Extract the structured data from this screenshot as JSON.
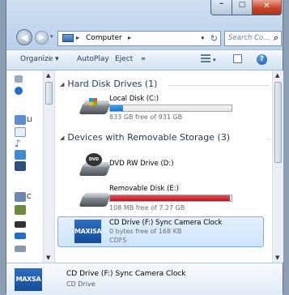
{
  "address": {
    "crumb": "Computer",
    "search_placeholder": "Search Co..."
  },
  "toolbar": {
    "organize": "Organize ▾",
    "autoplay": "AutoPlay",
    "eject": "Eject",
    "more": "»"
  },
  "nav_labels": [
    "Li",
    "C"
  ],
  "groups": [
    {
      "title": "Hard Disk Drives (1)"
    },
    {
      "title": "Devices with Removable Storage (3)"
    }
  ],
  "drives": [
    {
      "name": "Local Disk (C:)",
      "free": "833 GB free of 931 GB",
      "used_fraction": 0.105,
      "bar_color": "blue"
    },
    {
      "name": "DVD RW Drive (D:)"
    },
    {
      "name": "Removable Disk (E:)",
      "free": "108 MB free of 7.27 GB",
      "used_fraction": 0.985,
      "bar_color": "red"
    },
    {
      "name": "CD Drive (F:) Sync Camera Clock",
      "free": "0 bytes free of 168 KB",
      "fs": "CDFS",
      "logo": "MAXISA"
    }
  ],
  "details": {
    "name": "CD Drive (F:) Sync Camera Clock",
    "type": "CD Drive",
    "logo": "MAXSA"
  },
  "colors": {
    "accent": "#1a73c9",
    "warn": "#c8101e",
    "selection": "#cde4fb"
  }
}
